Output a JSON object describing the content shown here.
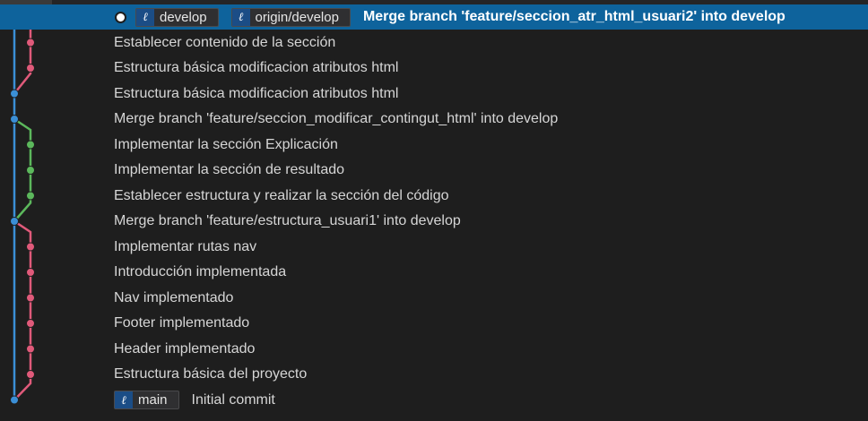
{
  "colors": {
    "background": "#1e1e1e",
    "selected_row": "#0e639c",
    "lane_blue": "#3b8fd6",
    "lane_pink": "#e05a7a",
    "lane_green": "#5cb85c",
    "ref_icon_bg": "#1b4d86"
  },
  "icons": {
    "branch": "git-branch-icon",
    "head": "head-commit-dot-icon"
  },
  "commits": [
    {
      "message": "Merge branch 'feature/seccion_atr_html_usuari2' into develop",
      "lane": "blue",
      "refs": [
        "develop",
        "origin/develop"
      ],
      "selected": true,
      "head": true
    },
    {
      "message": "Establecer contenido de la sección",
      "lane": "pink"
    },
    {
      "message": "Estructura básica modificacion atributos html",
      "lane": "pink"
    },
    {
      "message": "Estructura básica modificacion atributos html",
      "lane": "blue"
    },
    {
      "message": "Merge branch 'feature/seccion_modificar_contingut_html' into develop",
      "lane": "blue"
    },
    {
      "message": "Implementar la sección Explicación",
      "lane": "green"
    },
    {
      "message": "Implementar la sección de resultado",
      "lane": "green"
    },
    {
      "message": "Establecer estructura y realizar la sección del código",
      "lane": "green"
    },
    {
      "message": "Merge branch 'feature/estructura_usuari1' into develop",
      "lane": "blue"
    },
    {
      "message": "Implementar rutas nav",
      "lane": "pink"
    },
    {
      "message": "Introducción implementada",
      "lane": "pink"
    },
    {
      "message": "Nav implementado",
      "lane": "pink"
    },
    {
      "message": "Footer implementado",
      "lane": "pink"
    },
    {
      "message": "Header implementado",
      "lane": "pink"
    },
    {
      "message": "Estructura básica del proyecto",
      "lane": "pink"
    },
    {
      "message": "Initial commit",
      "lane": "blue",
      "refs": [
        "main"
      ]
    }
  ]
}
